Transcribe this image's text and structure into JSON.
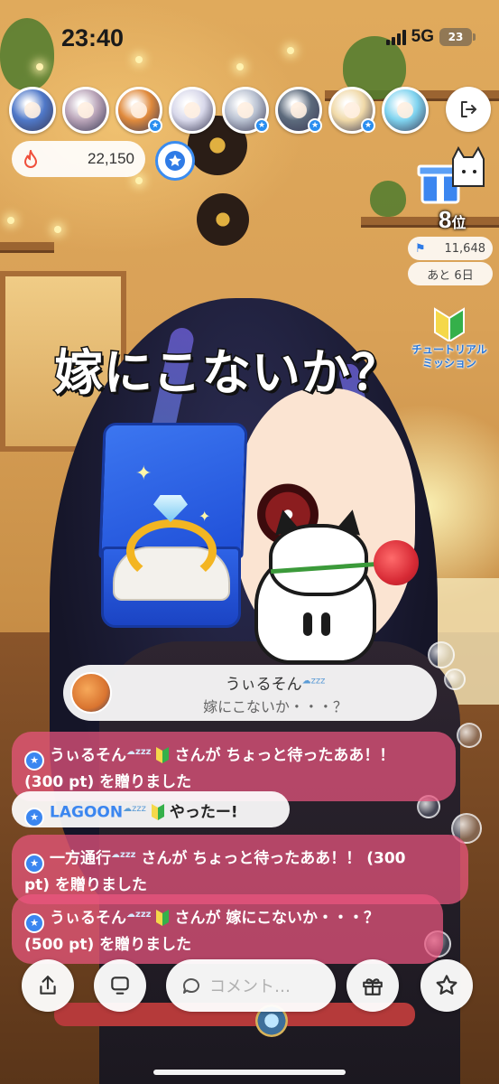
{
  "status_bar": {
    "time": "23:40",
    "network": "5G",
    "battery": "23"
  },
  "viewers": [
    {
      "name": "viewer-1",
      "color": "#4f78c8",
      "badge": ""
    },
    {
      "name": "viewer-2",
      "color": "#b9a4b8",
      "badge": ""
    },
    {
      "name": "viewer-3",
      "color": "#e08a3c",
      "badge": "★"
    },
    {
      "name": "viewer-4",
      "color": "#d8d8ea",
      "badge": ""
    },
    {
      "name": "viewer-5",
      "color": "#b8c0d0",
      "badge": "★"
    },
    {
      "name": "viewer-6",
      "color": "#5c6a7c",
      "badge": "★"
    },
    {
      "name": "viewer-7",
      "color": "#f0d9a8",
      "badge": "★"
    },
    {
      "name": "viewer-8",
      "color": "#7fd3ef",
      "badge": ""
    }
  ],
  "stream": {
    "points": "22,150",
    "rank_number": "8",
    "rank_suffix": "位",
    "rank_points": "11,648",
    "days_left": "あと 6日",
    "tutorial_label_1": "チュートリアル",
    "tutorial_label_2": "ミッション",
    "overlay_title": "嫁にこないか？"
  },
  "pinned": {
    "name": "うぃるそん",
    "name_suffix": "☁zzz",
    "text": "嫁にこないか・・・？"
  },
  "comments": [
    {
      "type": "gift",
      "name": "うぃるそん",
      "text_after": "さんが ちょっと待ったああ！！",
      "line2": "(300 pt) を贈りました"
    },
    {
      "type": "chat",
      "name": "LAGOON",
      "text_after": "やったー!"
    },
    {
      "type": "gift",
      "name": "一方通行",
      "text_after": "さんが ちょっと待ったああ！！ (300",
      "line2": "pt) を贈りました"
    },
    {
      "type": "gift",
      "name": "うぃるそん",
      "text_after": "さんが 嫁にこないか・・・？",
      "line2": "(500 pt) を贈りました"
    }
  ],
  "bottom_bar": {
    "comment_placeholder": "コメント…"
  },
  "colors": {
    "accent_blue": "#3b86f0",
    "gift_pink": "#ec5680",
    "ring_box_blue": "#2e63e6"
  }
}
